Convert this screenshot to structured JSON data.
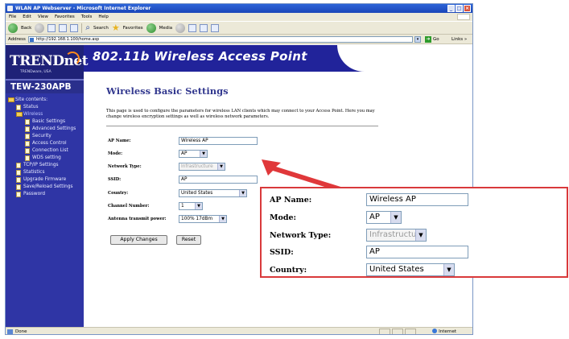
{
  "browser": {
    "title": "WLAN AP Webserver - Microsoft Internet Explorer",
    "menu": [
      "File",
      "Edit",
      "View",
      "Favorites",
      "Tools",
      "Help"
    ],
    "back_label": "Back",
    "search_label": "Search",
    "favorites_label": "Favorites",
    "media_label": "Media",
    "address_label": "Address",
    "url": "http://192.168.1.100/home.asp",
    "go_label": "Go",
    "links_label": "Links »",
    "status_text": "Done",
    "zone_text": "Internet"
  },
  "header": {
    "logo": "TRENDnet",
    "logo_tagline": "TRENDware, USA",
    "banner_title": "802.11b Wireless Access Point",
    "model": "TEW-230APB"
  },
  "sidebar": {
    "items": [
      {
        "label": "Site contents:",
        "icon": "folder-icon"
      },
      {
        "label": "Status",
        "icon": "doc-icon"
      },
      {
        "label": "Wireless",
        "icon": "folder-icon"
      },
      {
        "label": "Basic Settings",
        "icon": "doc-icon"
      },
      {
        "label": "Advanced Settings",
        "icon": "doc-icon"
      },
      {
        "label": "Security",
        "icon": "doc-icon"
      },
      {
        "label": "Access Control",
        "icon": "doc-icon"
      },
      {
        "label": "Connection List",
        "icon": "doc-icon"
      },
      {
        "label": "WDS setting",
        "icon": "doc-icon"
      },
      {
        "label": "TCP/IP Settings",
        "icon": "doc-icon"
      },
      {
        "label": "Statistics",
        "icon": "doc-icon"
      },
      {
        "label": "Upgrade Firmware",
        "icon": "doc-icon"
      },
      {
        "label": "Save/Reload Settings",
        "icon": "doc-icon"
      },
      {
        "label": "Password",
        "icon": "doc-icon"
      }
    ]
  },
  "content": {
    "title": "Wireless Basic Settings",
    "intro": "This page is used to configure the parameters for wireless LAN clients which may connect to your Access Point. Here you may change wireless encryption settings as well as wireless network parameters.",
    "form": {
      "ap_name_label": "AP Name:",
      "ap_name_value": "Wireless AP",
      "mode_label": "Mode:",
      "mode_value": "AP",
      "network_type_label": "Network Type:",
      "network_type_value": "Infrastructure",
      "ssid_label": "SSID:",
      "ssid_value": "AP",
      "country_label": "Country:",
      "country_value": "United States",
      "channel_label": "Channel Number:",
      "channel_value": "1",
      "power_label": "Antenna transmit power:",
      "power_value": "100% 17dBm"
    },
    "apply_label": "Apply Changes",
    "reset_label": "Reset"
  },
  "colors": {
    "banner": "#21239a",
    "sidebar": "#2f35a5",
    "heading": "#33398f",
    "callout_border": "#d9393b"
  }
}
